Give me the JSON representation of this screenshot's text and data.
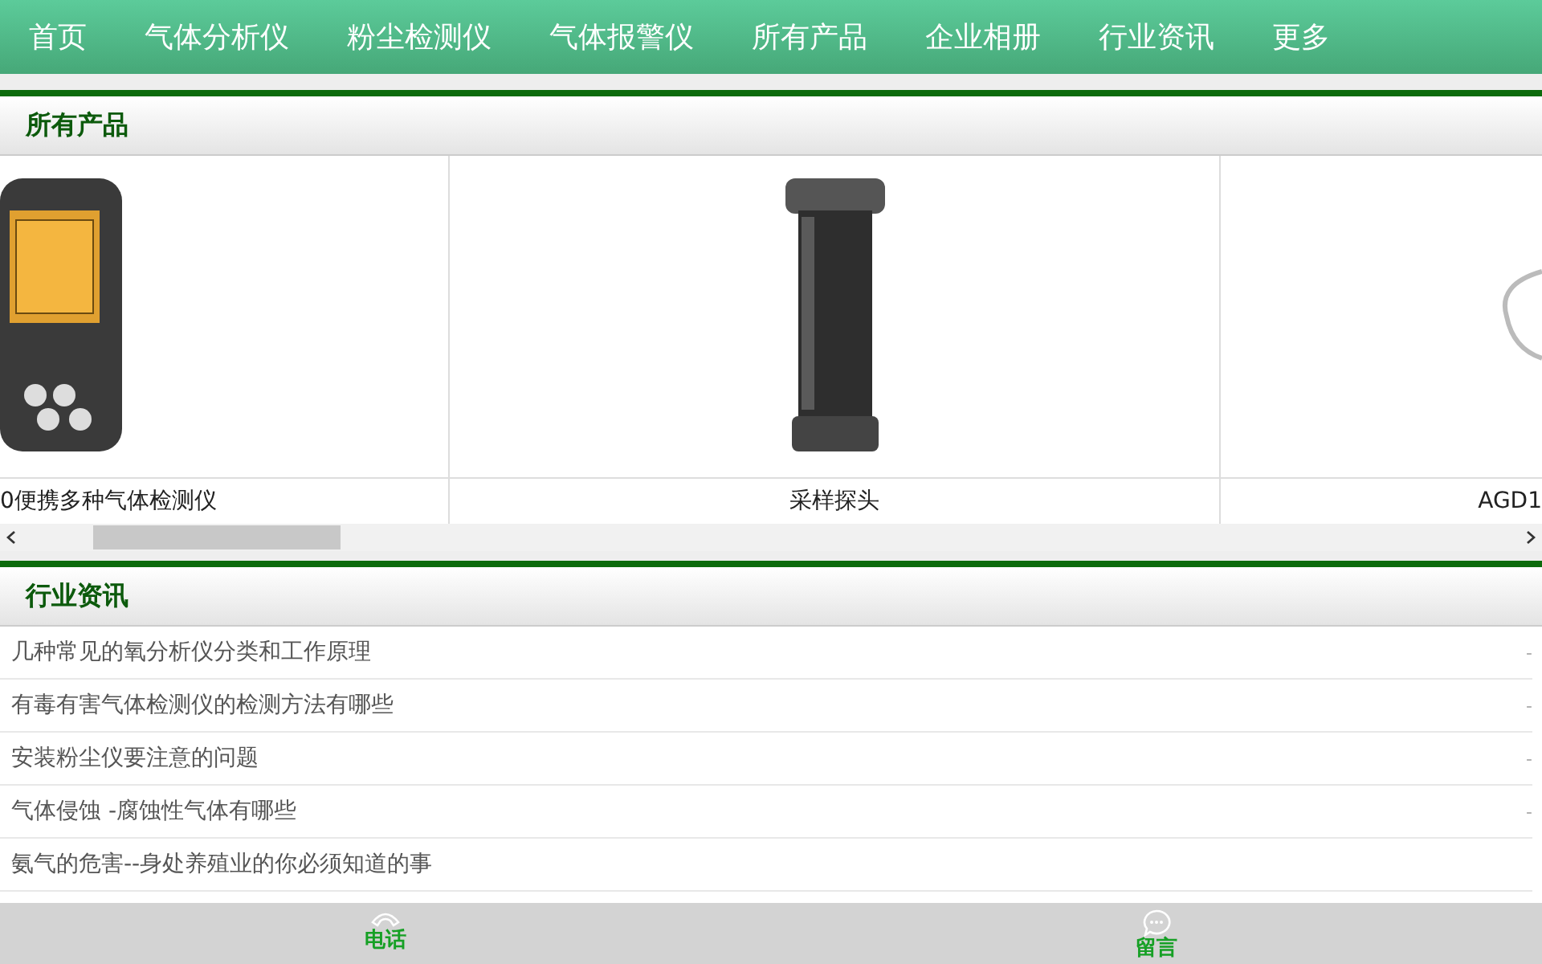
{
  "nav": [
    {
      "label": "首页"
    },
    {
      "label": "气体分析仪"
    },
    {
      "label": "粉尘检测仪"
    },
    {
      "label": "气体报警仪"
    },
    {
      "label": "所有产品"
    },
    {
      "label": "企业相册"
    },
    {
      "label": "行业资讯"
    },
    {
      "label": "更多"
    }
  ],
  "products": {
    "title": "所有产品",
    "items": [
      {
        "name": "0便携多种气体检测仪",
        "kind": "detector"
      },
      {
        "name": "采样探头",
        "kind": "probe"
      },
      {
        "name": "AGD1",
        "kind": "cable"
      }
    ]
  },
  "news": {
    "title": "行业资讯",
    "items": [
      {
        "title": "几种常见的氧分析仪分类和工作原理",
        "date": "-"
      },
      {
        "title": "有毒有害气体检测仪的检测方法有哪些",
        "date": "-"
      },
      {
        "title": "安装粉尘仪要注意的问题",
        "date": "-"
      },
      {
        "title": "气体侵蚀 -腐蚀性气体有哪些",
        "date": "-"
      },
      {
        "title": "氨气的危害--身处养殖业的你必须知道的事"
      }
    ]
  },
  "bottom_bar": [
    {
      "label": "电话",
      "kind": "phone"
    },
    {
      "label": "留言",
      "kind": "message"
    }
  ]
}
